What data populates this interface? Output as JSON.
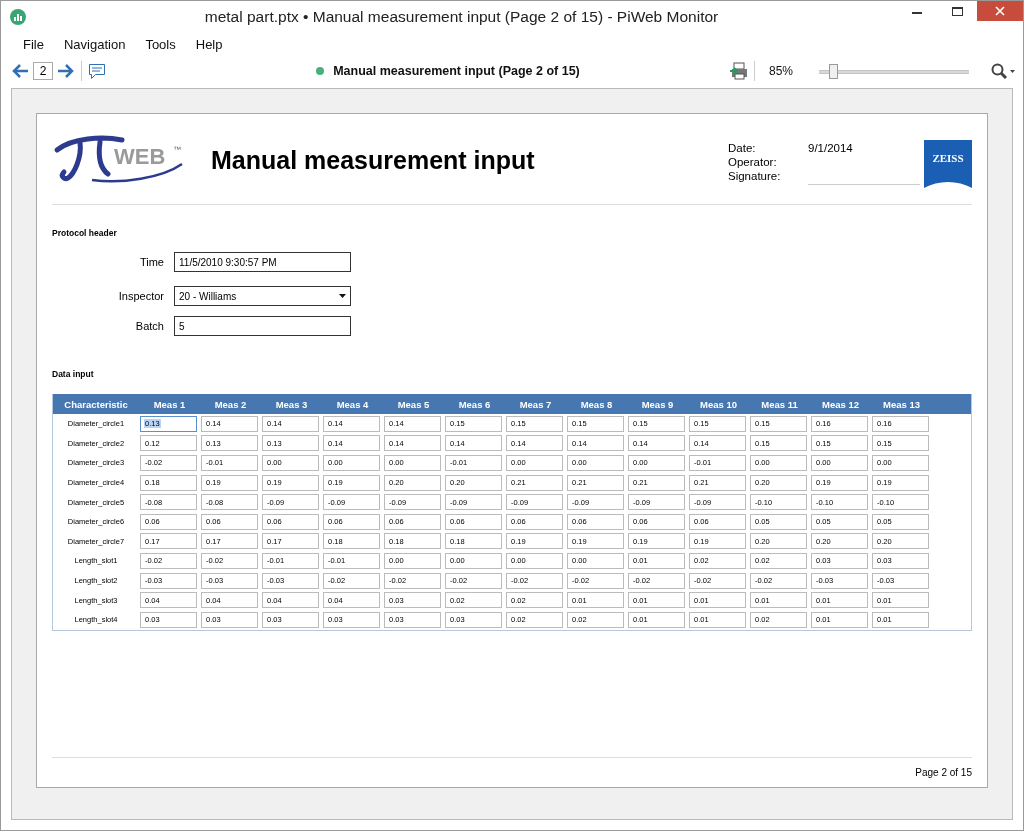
{
  "window": {
    "title": "metal part.ptx • Manual measurement input (Page 2 of 15) - PiWeb Monitor"
  },
  "menu": [
    "File",
    "Navigation",
    "Tools",
    "Help"
  ],
  "toolbar": {
    "page": "2",
    "document_title": "Manual measurement input (Page 2 of 15)",
    "zoom": "85%",
    "zoom_slider": {
      "level": 0.07
    }
  },
  "report": {
    "logo": {
      "text": "WEB",
      "trademark": "™"
    },
    "title": "Manual measurement input",
    "meta": [
      {
        "kind": "text",
        "label": "Date:",
        "value": "9/1/2014"
      },
      {
        "kind": "text",
        "label": "Operator:"
      },
      {
        "kind": "signature",
        "label": "Signature:"
      }
    ],
    "brand_logo": "ZEISS",
    "protocol_header": {
      "heading": "Protocol header",
      "fields": [
        {
          "kind": "text",
          "label": "Time",
          "value": "11/5/2010 9:30:57 PM"
        },
        {
          "kind": "dropdown",
          "label": "Inspector",
          "value": "20 - Williams"
        },
        {
          "kind": "text",
          "label": "Batch",
          "value": "5"
        }
      ]
    },
    "data_input": {
      "heading": "Data input",
      "columns": [
        "Characteristic",
        "Meas 1",
        "Meas 2",
        "Meas 3",
        "Meas 4",
        "Meas 5",
        "Meas 6",
        "Meas 7",
        "Meas 8",
        "Meas 9",
        "Meas 10",
        "Meas 11",
        "Meas 12",
        "Meas 13"
      ],
      "rows": [
        {
          "characteristic": "Diameter_circle1",
          "cells": [
            {
              "value": "0.13",
              "selected": true
            },
            {
              "value": "0.14",
              "selected": false
            },
            {
              "value": "0.14",
              "selected": false
            },
            {
              "value": "0.14",
              "selected": false
            },
            {
              "value": "0.14",
              "selected": false
            },
            {
              "value": "0.15",
              "selected": false
            },
            {
              "value": "0.15",
              "selected": false
            },
            {
              "value": "0.15",
              "selected": false
            },
            {
              "value": "0.15",
              "selected": false
            },
            {
              "value": "0.15",
              "selected": false
            },
            {
              "value": "0.15",
              "selected": false
            },
            {
              "value": "0.16",
              "selected": false
            },
            {
              "value": "0.16",
              "selected": false
            }
          ]
        },
        {
          "characteristic": "Diameter_circle2",
          "cells": [
            {
              "value": "0.12",
              "selected": false
            },
            {
              "value": "0.13",
              "selected": false
            },
            {
              "value": "0.13",
              "selected": false
            },
            {
              "value": "0.14",
              "selected": false
            },
            {
              "value": "0.14",
              "selected": false
            },
            {
              "value": "0.14",
              "selected": false
            },
            {
              "value": "0.14",
              "selected": false
            },
            {
              "value": "0.14",
              "selected": false
            },
            {
              "value": "0.14",
              "selected": false
            },
            {
              "value": "0.14",
              "selected": false
            },
            {
              "value": "0.15",
              "selected": false
            },
            {
              "value": "0.15",
              "selected": false
            },
            {
              "value": "0.15",
              "selected": false
            }
          ]
        },
        {
          "characteristic": "Diameter_circle3",
          "cells": [
            {
              "value": "-0.02",
              "selected": false
            },
            {
              "value": "-0.01",
              "selected": false
            },
            {
              "value": "0.00",
              "selected": false
            },
            {
              "value": "0.00",
              "selected": false
            },
            {
              "value": "0.00",
              "selected": false
            },
            {
              "value": "-0.01",
              "selected": false
            },
            {
              "value": "0.00",
              "selected": false
            },
            {
              "value": "0.00",
              "selected": false
            },
            {
              "value": "0.00",
              "selected": false
            },
            {
              "value": "-0.01",
              "selected": false
            },
            {
              "value": "0.00",
              "selected": false
            },
            {
              "value": "0.00",
              "selected": false
            },
            {
              "value": "0.00",
              "selected": false
            }
          ]
        },
        {
          "characteristic": "Diameter_circle4",
          "cells": [
            {
              "value": "0.18",
              "selected": false
            },
            {
              "value": "0.19",
              "selected": false
            },
            {
              "value": "0.19",
              "selected": false
            },
            {
              "value": "0.19",
              "selected": false
            },
            {
              "value": "0.20",
              "selected": false
            },
            {
              "value": "0.20",
              "selected": false
            },
            {
              "value": "0.21",
              "selected": false
            },
            {
              "value": "0.21",
              "selected": false
            },
            {
              "value": "0.21",
              "selected": false
            },
            {
              "value": "0.21",
              "selected": false
            },
            {
              "value": "0.20",
              "selected": false
            },
            {
              "value": "0.19",
              "selected": false
            },
            {
              "value": "0.19",
              "selected": false
            }
          ]
        },
        {
          "characteristic": "Diameter_circle5",
          "cells": [
            {
              "value": "-0.08",
              "selected": false
            },
            {
              "value": "-0.08",
              "selected": false
            },
            {
              "value": "-0.09",
              "selected": false
            },
            {
              "value": "-0.09",
              "selected": false
            },
            {
              "value": "-0.09",
              "selected": false
            },
            {
              "value": "-0.09",
              "selected": false
            },
            {
              "value": "-0.09",
              "selected": false
            },
            {
              "value": "-0.09",
              "selected": false
            },
            {
              "value": "-0.09",
              "selected": false
            },
            {
              "value": "-0.09",
              "selected": false
            },
            {
              "value": "-0.10",
              "selected": false
            },
            {
              "value": "-0.10",
              "selected": false
            },
            {
              "value": "-0.10",
              "selected": false
            }
          ]
        },
        {
          "characteristic": "Diameter_circle6",
          "cells": [
            {
              "value": "0.06",
              "selected": false
            },
            {
              "value": "0.06",
              "selected": false
            },
            {
              "value": "0.06",
              "selected": false
            },
            {
              "value": "0.06",
              "selected": false
            },
            {
              "value": "0.06",
              "selected": false
            },
            {
              "value": "0.06",
              "selected": false
            },
            {
              "value": "0.06",
              "selected": false
            },
            {
              "value": "0.06",
              "selected": false
            },
            {
              "value": "0.06",
              "selected": false
            },
            {
              "value": "0.06",
              "selected": false
            },
            {
              "value": "0.05",
              "selected": false
            },
            {
              "value": "0.05",
              "selected": false
            },
            {
              "value": "0.05",
              "selected": false
            }
          ]
        },
        {
          "characteristic": "Diameter_circle7",
          "cells": [
            {
              "value": "0.17",
              "selected": false
            },
            {
              "value": "0.17",
              "selected": false
            },
            {
              "value": "0.17",
              "selected": false
            },
            {
              "value": "0.18",
              "selected": false
            },
            {
              "value": "0.18",
              "selected": false
            },
            {
              "value": "0.18",
              "selected": false
            },
            {
              "value": "0.19",
              "selected": false
            },
            {
              "value": "0.19",
              "selected": false
            },
            {
              "value": "0.19",
              "selected": false
            },
            {
              "value": "0.19",
              "selected": false
            },
            {
              "value": "0.20",
              "selected": false
            },
            {
              "value": "0.20",
              "selected": false
            },
            {
              "value": "0.20",
              "selected": false
            }
          ]
        },
        {
          "characteristic": "Length_slot1",
          "cells": [
            {
              "value": "-0.02",
              "selected": false
            },
            {
              "value": "-0.02",
              "selected": false
            },
            {
              "value": "-0.01",
              "selected": false
            },
            {
              "value": "-0.01",
              "selected": false
            },
            {
              "value": "0.00",
              "selected": false
            },
            {
              "value": "0.00",
              "selected": false
            },
            {
              "value": "0.00",
              "selected": false
            },
            {
              "value": "0.00",
              "selected": false
            },
            {
              "value": "0.01",
              "selected": false
            },
            {
              "value": "0.02",
              "selected": false
            },
            {
              "value": "0.02",
              "selected": false
            },
            {
              "value": "0.03",
              "selected": false
            },
            {
              "value": "0.03",
              "selected": false
            }
          ]
        },
        {
          "characteristic": "Length_slot2",
          "cells": [
            {
              "value": "-0.03",
              "selected": false
            },
            {
              "value": "-0.03",
              "selected": false
            },
            {
              "value": "-0.03",
              "selected": false
            },
            {
              "value": "-0.02",
              "selected": false
            },
            {
              "value": "-0.02",
              "selected": false
            },
            {
              "value": "-0.02",
              "selected": false
            },
            {
              "value": "-0.02",
              "selected": false
            },
            {
              "value": "-0.02",
              "selected": false
            },
            {
              "value": "-0.02",
              "selected": false
            },
            {
              "value": "-0.02",
              "selected": false
            },
            {
              "value": "-0.02",
              "selected": false
            },
            {
              "value": "-0.03",
              "selected": false
            },
            {
              "value": "-0.03",
              "selected": false
            }
          ]
        },
        {
          "characteristic": "Length_slot3",
          "cells": [
            {
              "value": "0.04",
              "selected": false
            },
            {
              "value": "0.04",
              "selected": false
            },
            {
              "value": "0.04",
              "selected": false
            },
            {
              "value": "0.04",
              "selected": false
            },
            {
              "value": "0.03",
              "selected": false
            },
            {
              "value": "0.02",
              "selected": false
            },
            {
              "value": "0.02",
              "selected": false
            },
            {
              "value": "0.01",
              "selected": false
            },
            {
              "value": "0.01",
              "selected": false
            },
            {
              "value": "0.01",
              "selected": false
            },
            {
              "value": "0.01",
              "selected": false
            },
            {
              "value": "0.01",
              "selected": false
            },
            {
              "value": "0.01",
              "selected": false
            }
          ]
        },
        {
          "characteristic": "Length_slot4",
          "cells": [
            {
              "value": "0.03",
              "selected": false
            },
            {
              "value": "0.03",
              "selected": false
            },
            {
              "value": "0.03",
              "selected": false
            },
            {
              "value": "0.03",
              "selected": false
            },
            {
              "value": "0.03",
              "selected": false
            },
            {
              "value": "0.03",
              "selected": false
            },
            {
              "value": "0.02",
              "selected": false
            },
            {
              "value": "0.02",
              "selected": false
            },
            {
              "value": "0.01",
              "selected": false
            },
            {
              "value": "0.01",
              "selected": false
            },
            {
              "value": "0.02",
              "selected": false
            },
            {
              "value": "0.01",
              "selected": false
            },
            {
              "value": "0.01",
              "selected": false
            }
          ]
        }
      ]
    }
  },
  "footer": "Page 2 of 15"
}
